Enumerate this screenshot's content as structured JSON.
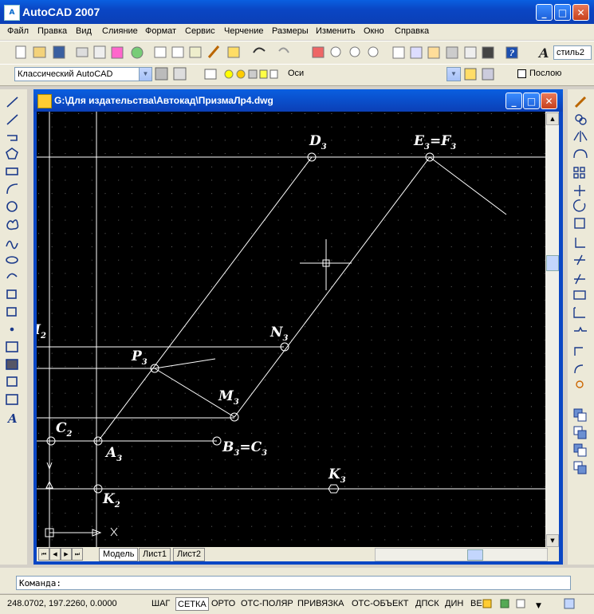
{
  "window": {
    "title": "AutoCAD 2007",
    "app_icon": "A"
  },
  "menu": [
    "Файл",
    "Правка",
    "Вид",
    "Слияние",
    "Формат",
    "Сервис",
    "Черчение",
    "Размеры",
    "Изменить",
    "Окно",
    "Справка"
  ],
  "toolbar": {
    "workspace_combo": "Классический AutoCAD",
    "layer_combo": "Оси",
    "text_style_combo": "стиль2",
    "linetype_combo": "Послою"
  },
  "drawing": {
    "title": "G:\\Для издательства\\Автокад\\ПризмаЛр4.dwg",
    "labels": {
      "D": "D",
      "D_sub": "3",
      "E": "E",
      "E_sub": "3",
      "eq1": "=F",
      "F_sub": "3",
      "N": "N",
      "N_sub": "3",
      "P": "P",
      "P_sub": "3",
      "M": "M",
      "M_sub": "3",
      "C": "C",
      "C_sub": "2",
      "A": "A",
      "A_sub": "3",
      "B": "B",
      "B_sub": "3",
      "eq2": "=C",
      "C3_sub": "3",
      "K3": "K",
      "K3_sub": "3",
      "K2": "K",
      "K2_sub": "2",
      "I2": "I",
      "I2_sub": "2",
      "ucs_x": "X"
    },
    "tabs": [
      "Модель",
      "Лист1",
      "Лист2"
    ]
  },
  "command": {
    "prompt": "Команда:"
  },
  "status": {
    "coords": "248.0702, 197.2260, 0.0000",
    "toggles": [
      "ШАГ",
      "СЕТКА",
      "ОРТО",
      "ОТС-ПОЛЯР",
      "ПРИВЯЗКА",
      "ОТС-ОБЪЕКТ",
      "ДПСК",
      "ДИН",
      "ВЕ"
    ],
    "active": [
      "СЕТКА"
    ]
  },
  "colors": {
    "titlebar": "#0a46c4",
    "canvas": "#000000",
    "chrome": "#ece9d8"
  }
}
